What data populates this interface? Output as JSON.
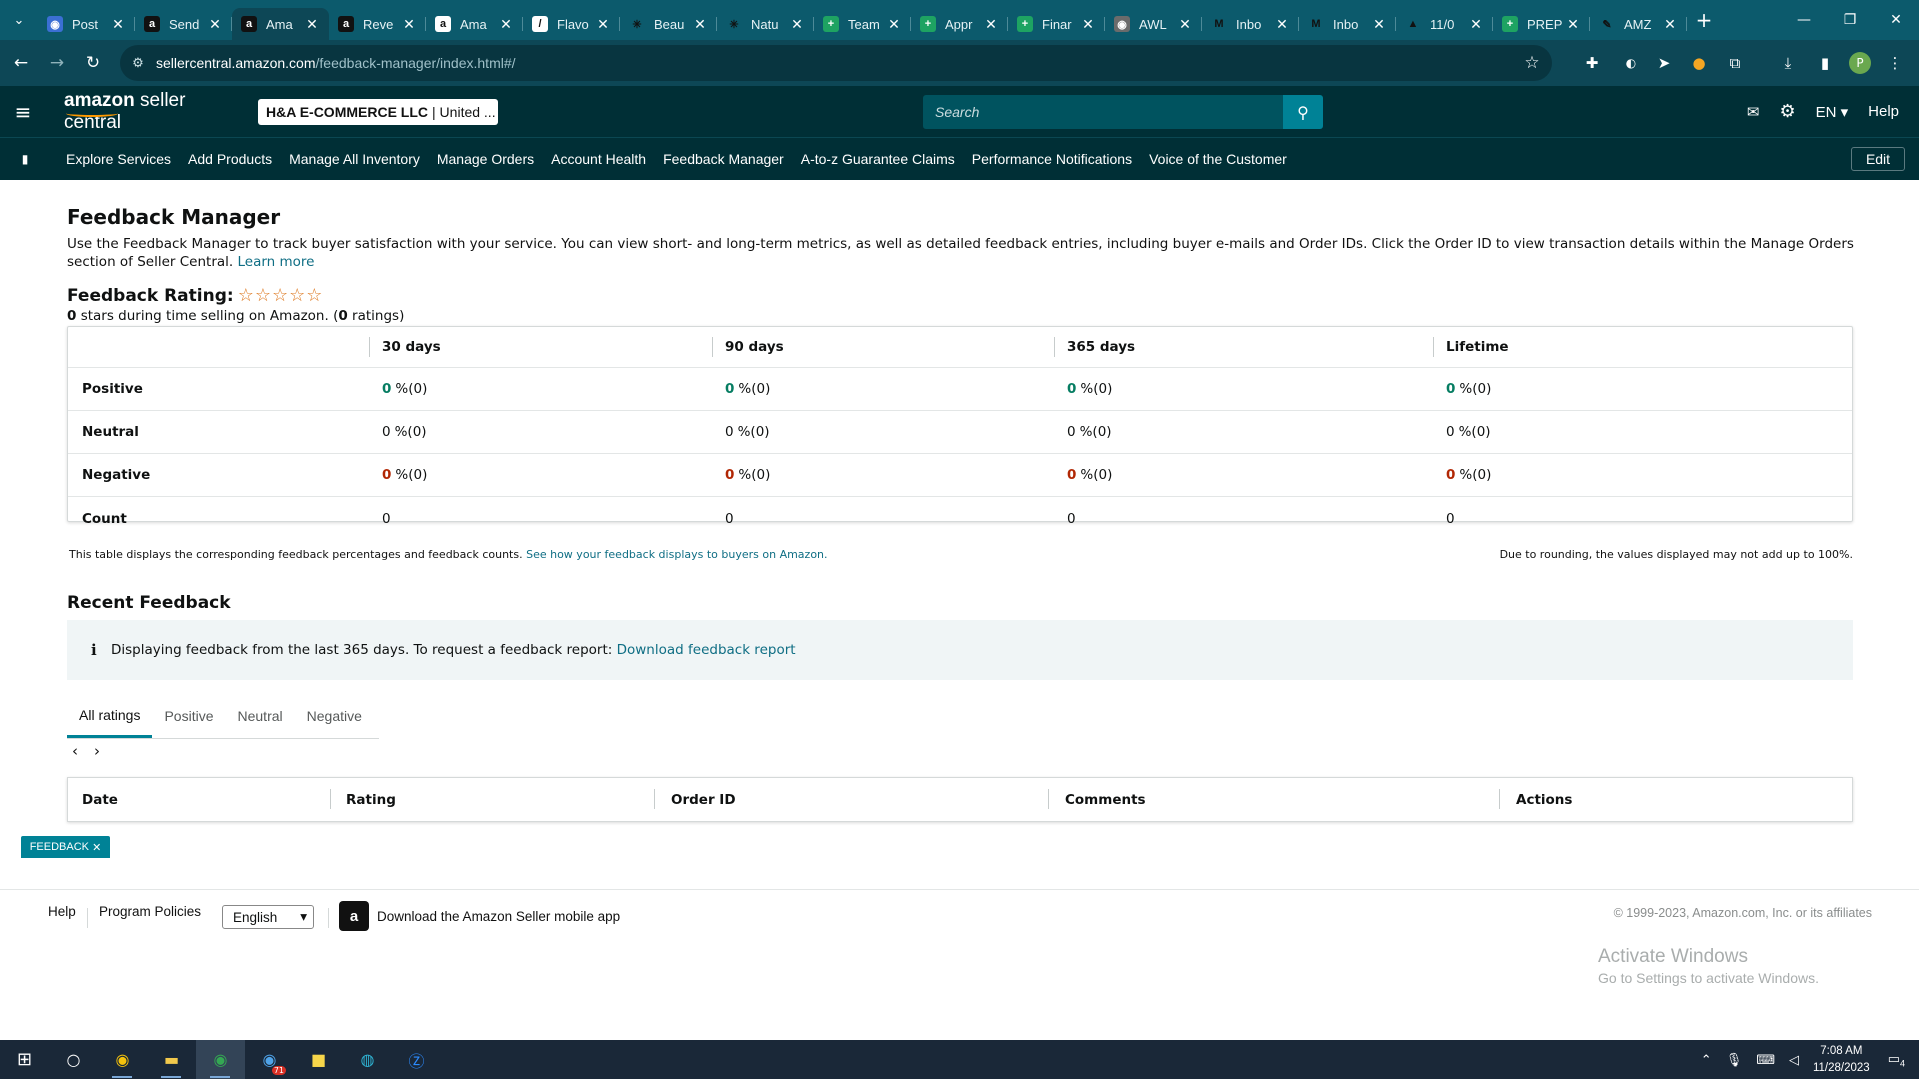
{
  "browser": {
    "tabs": [
      {
        "title": "Post",
        "icon": "globe-icon",
        "color": "#3b6fd4",
        "glyph": "◉"
      },
      {
        "title": "Send",
        "icon": "amazon-icon",
        "color": "#111111",
        "glyph": "a"
      },
      {
        "title": "Ama",
        "icon": "amazon-icon",
        "color": "#111111",
        "glyph": "a",
        "active": true
      },
      {
        "title": "Reve",
        "icon": "amazon-icon",
        "color": "#111111",
        "glyph": "a"
      },
      {
        "title": "Ama",
        "icon": "amazon-icon",
        "color": "#ffffff",
        "glyph": "a"
      },
      {
        "title": "Flavo",
        "icon": "flavo-icon",
        "color": "#ffffff",
        "glyph": "/"
      },
      {
        "title": "Beau",
        "icon": "sparkle-icon",
        "color": "#0c5a6c",
        "glyph": "✳"
      },
      {
        "title": "Natu",
        "icon": "sparkle-icon",
        "color": "#0c5a6c",
        "glyph": "✳"
      },
      {
        "title": "Team",
        "icon": "sheets-icon",
        "color": "#1ea362",
        "glyph": "+"
      },
      {
        "title": "Appr",
        "icon": "sheets-icon",
        "color": "#1ea362",
        "glyph": "+"
      },
      {
        "title": "Finar",
        "icon": "sheets-icon",
        "color": "#1ea362",
        "glyph": "+"
      },
      {
        "title": "AWL",
        "icon": "globe-icon",
        "color": "#6b6b6b",
        "glyph": "◉"
      },
      {
        "title": "Inbo",
        "icon": "gmail-icon",
        "color": "#0c5a6c",
        "glyph": "M"
      },
      {
        "title": "Inbo",
        "icon": "gmail-icon",
        "color": "#0c5a6c",
        "glyph": "M"
      },
      {
        "title": "11/0",
        "icon": "drive-icon",
        "color": "#0c5a6c",
        "glyph": "▲"
      },
      {
        "title": "PREP",
        "icon": "sheets-icon",
        "color": "#1ea362",
        "glyph": "+"
      },
      {
        "title": "AMZ",
        "icon": "feather-icon",
        "color": "#0c5a6c",
        "glyph": "✎"
      }
    ],
    "url_host": "sellercentral.amazon.com",
    "url_path": "/feedback-manager/index.html#/"
  },
  "header": {
    "logo_main": "amazon",
    "logo_sub": "seller central",
    "account_bold": "H&A E-COMMERCE LLC",
    "account_rest": "| United ...",
    "search_placeholder": "Search",
    "language": "EN",
    "help": "Help"
  },
  "subnav": {
    "items": [
      "Explore Services",
      "Add Products",
      "Manage All Inventory",
      "Manage Orders",
      "Account Health",
      "Feedback Manager",
      "A-to-z Guarantee Claims",
      "Performance Notifications",
      "Voice of the Customer"
    ],
    "edit": "Edit"
  },
  "page": {
    "title": "Feedback Manager",
    "intro": "Use the Feedback Manager to track buyer satisfaction with your service. You can view short- and long-term metrics, as well as detailed feedback entries, including buyer e-mails and Order IDs. Click the Order ID to view transaction details within the Manage Orders section of Seller Central.",
    "learn_more": "Learn more",
    "rating_label": "Feedback Rating:",
    "rating_stars": 0,
    "rating_sub_value": "0",
    "rating_sub_text": "stars during time selling on Amazon. (",
    "rating_count": "0",
    "rating_count_text": "ratings)",
    "table": {
      "columns": [
        "30 days",
        "90 days",
        "365 days",
        "Lifetime"
      ],
      "rows": [
        {
          "label": "Positive",
          "kind": "pos",
          "cells": [
            [
              "0",
              "%(0)"
            ],
            [
              "0",
              "%(0)"
            ],
            [
              "0",
              "%(0)"
            ],
            [
              "0",
              "%(0)"
            ]
          ]
        },
        {
          "label": "Neutral",
          "kind": "neu",
          "cells": [
            [
              "0",
              "%(0)"
            ],
            [
              "0",
              "%(0)"
            ],
            [
              "0",
              "%(0)"
            ],
            [
              "0",
              "%(0)"
            ]
          ]
        },
        {
          "label": "Negative",
          "kind": "neg",
          "cells": [
            [
              "0",
              "%(0)"
            ],
            [
              "0",
              "%(0)"
            ],
            [
              "0",
              "%(0)"
            ],
            [
              "0",
              "%(0)"
            ]
          ]
        },
        {
          "label": "Count",
          "kind": "count",
          "cells": [
            [
              "0",
              ""
            ],
            [
              "0",
              ""
            ],
            [
              "0",
              ""
            ],
            [
              "0",
              ""
            ]
          ]
        }
      ]
    },
    "note_left": "This table displays the corresponding feedback percentages and feedback counts.",
    "note_link": "See how your feedback displays to buyers on Amazon.",
    "note_right": "Due to rounding, the values displayed may not add up to 100%.",
    "recent_title": "Recent Feedback",
    "info_text": "Displaying feedback from the last 365 days. To request a feedback report:",
    "info_link": "Download feedback report",
    "tabs": [
      "All ratings",
      "Positive",
      "Neutral",
      "Negative"
    ],
    "recent_columns": [
      "Date",
      "Rating",
      "Order ID",
      "Comments",
      "Actions"
    ]
  },
  "footer": {
    "help": "Help",
    "policies": "Program Policies",
    "language": "English",
    "app_text": "Download the Amazon Seller mobile app",
    "copyright": "© 1999-2023, Amazon.com, Inc. or its affiliates",
    "feedback_tag": "FEEDBACK",
    "activate_title": "Activate Windows",
    "activate_sub": "Go to Settings to activate Windows."
  },
  "taskbar": {
    "time": "7:08 AM",
    "date": "11/28/2023",
    "notif_count": "4",
    "app_badge": "71"
  }
}
